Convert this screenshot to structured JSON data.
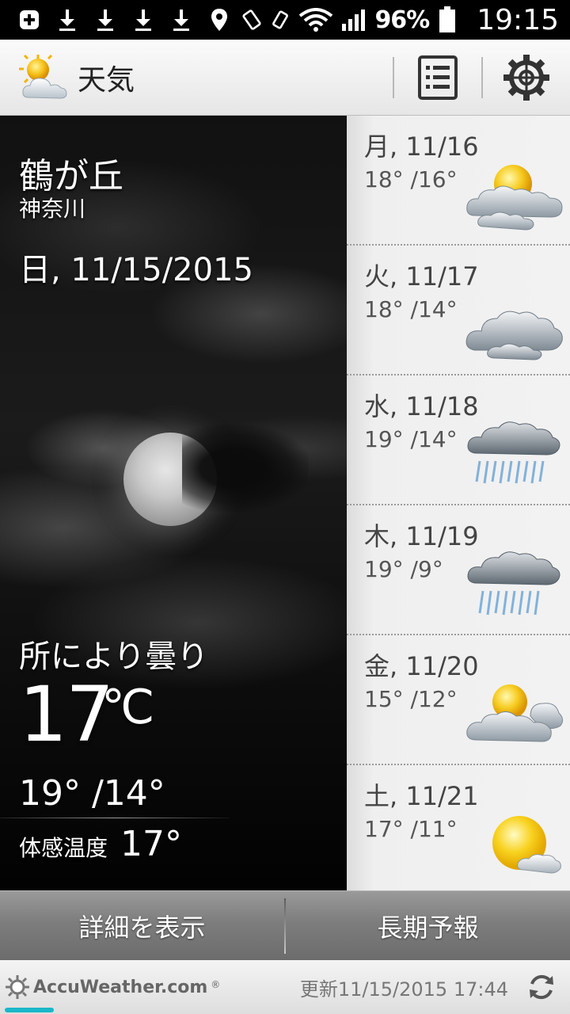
{
  "status_bar": {
    "battery": "96%",
    "time": "19:15",
    "icons": [
      "plus-icon",
      "download-icon",
      "download-icon",
      "download-icon",
      "download-icon",
      "location-icon",
      "rotate-icon",
      "vibrate-icon",
      "wifi-icon",
      "signal-icon",
      "battery-icon"
    ]
  },
  "app_bar": {
    "title": "天気",
    "logo_icon": "sun-cloud-icon",
    "actions": [
      "list-icon",
      "gear-icon"
    ]
  },
  "current": {
    "city": "鶴が丘",
    "prefecture": "神奈川",
    "date": "日, 11/15/2015",
    "condition": "所により曇り",
    "temperature": "17",
    "unit": "℃",
    "high_low": "19°  /14°",
    "feels_label": "体感温度",
    "feels_value": "17°"
  },
  "forecast": [
    {
      "day": "月, 11/16",
      "temps": "18°  /16°",
      "icon": "partly-sunny-icon"
    },
    {
      "day": "火, 11/17",
      "temps": "18°  /14°",
      "icon": "cloudy-icon"
    },
    {
      "day": "水, 11/18",
      "temps": "19°  /14°",
      "icon": "rain-icon"
    },
    {
      "day": "木, 11/19",
      "temps": "19°  /9°",
      "icon": "rain-icon"
    },
    {
      "day": "金, 11/20",
      "temps": "15°  /12°",
      "icon": "partly-sunny-icon"
    },
    {
      "day": "土, 11/21",
      "temps": "17°  /11°",
      "icon": "mostly-sunny-icon"
    }
  ],
  "actions": {
    "details": "詳細を表示",
    "long_term": "長期予報"
  },
  "footer": {
    "brand": "AccuWeather.com",
    "registered": "®",
    "updated": "更新11/15/2015 17:44"
  },
  "colors": {
    "accent": "#1ab7c7",
    "sun": "#f7c21a"
  }
}
